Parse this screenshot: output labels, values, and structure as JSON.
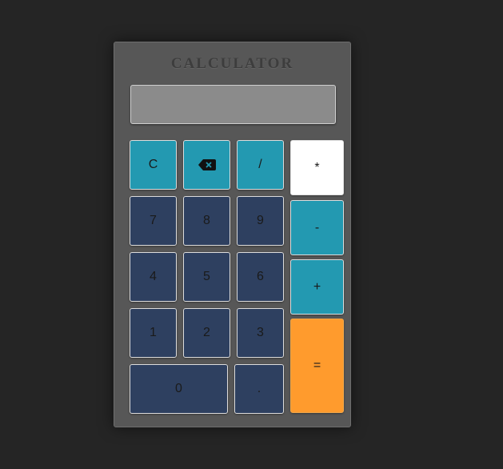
{
  "calculator": {
    "title": "CALCULATOR",
    "display_value": "",
    "keys": {
      "clear": "C",
      "backspace_icon": "backspace-icon",
      "divide": "/",
      "multiply": "*",
      "minus": "-",
      "plus": "+",
      "equals": "=",
      "seven": "7",
      "eight": "8",
      "nine": "9",
      "four": "4",
      "five": "5",
      "six": "6",
      "one": "1",
      "two": "2",
      "three": "3",
      "zero": "0",
      "decimal": "."
    }
  },
  "colors": {
    "background": "#252525",
    "body": "#575757",
    "display": "#8b8b8b",
    "operator_teal": "#2399b1",
    "number_navy": "#2e4060",
    "equals_orange": "#ff9b2d",
    "multiply_white": "#ffffff"
  }
}
